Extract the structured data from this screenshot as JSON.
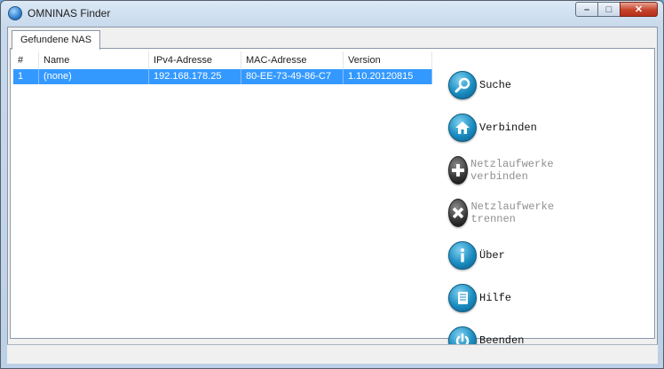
{
  "window": {
    "title": "OMNINAS Finder",
    "minimize": "–",
    "maximize": "□",
    "close": "✕"
  },
  "tabs": [
    {
      "label": "Gefundene NAS"
    }
  ],
  "table": {
    "columns": [
      "#",
      "Name",
      "IPv4-Adresse",
      "MAC-Adresse",
      "Version"
    ],
    "rows": [
      [
        "1",
        "(none)",
        "192.168.178.25",
        "80-EE-73-49-86-C7",
        "1.10.20120815"
      ]
    ]
  },
  "actions": [
    {
      "label": "Suche",
      "icon": "search-icon",
      "enabled": true
    },
    {
      "label": "Verbinden",
      "icon": "home-icon",
      "enabled": true
    },
    {
      "label": "Netzlaufwerke verbinden",
      "icon": "plus-icon",
      "enabled": false
    },
    {
      "label": "Netzlaufwerke trennen",
      "icon": "close-x-icon",
      "enabled": false
    },
    {
      "label": "Über",
      "icon": "info-icon",
      "enabled": true
    },
    {
      "label": "Hilfe",
      "icon": "book-icon",
      "enabled": true
    },
    {
      "label": "Beenden",
      "icon": "power-icon",
      "enabled": true
    }
  ]
}
